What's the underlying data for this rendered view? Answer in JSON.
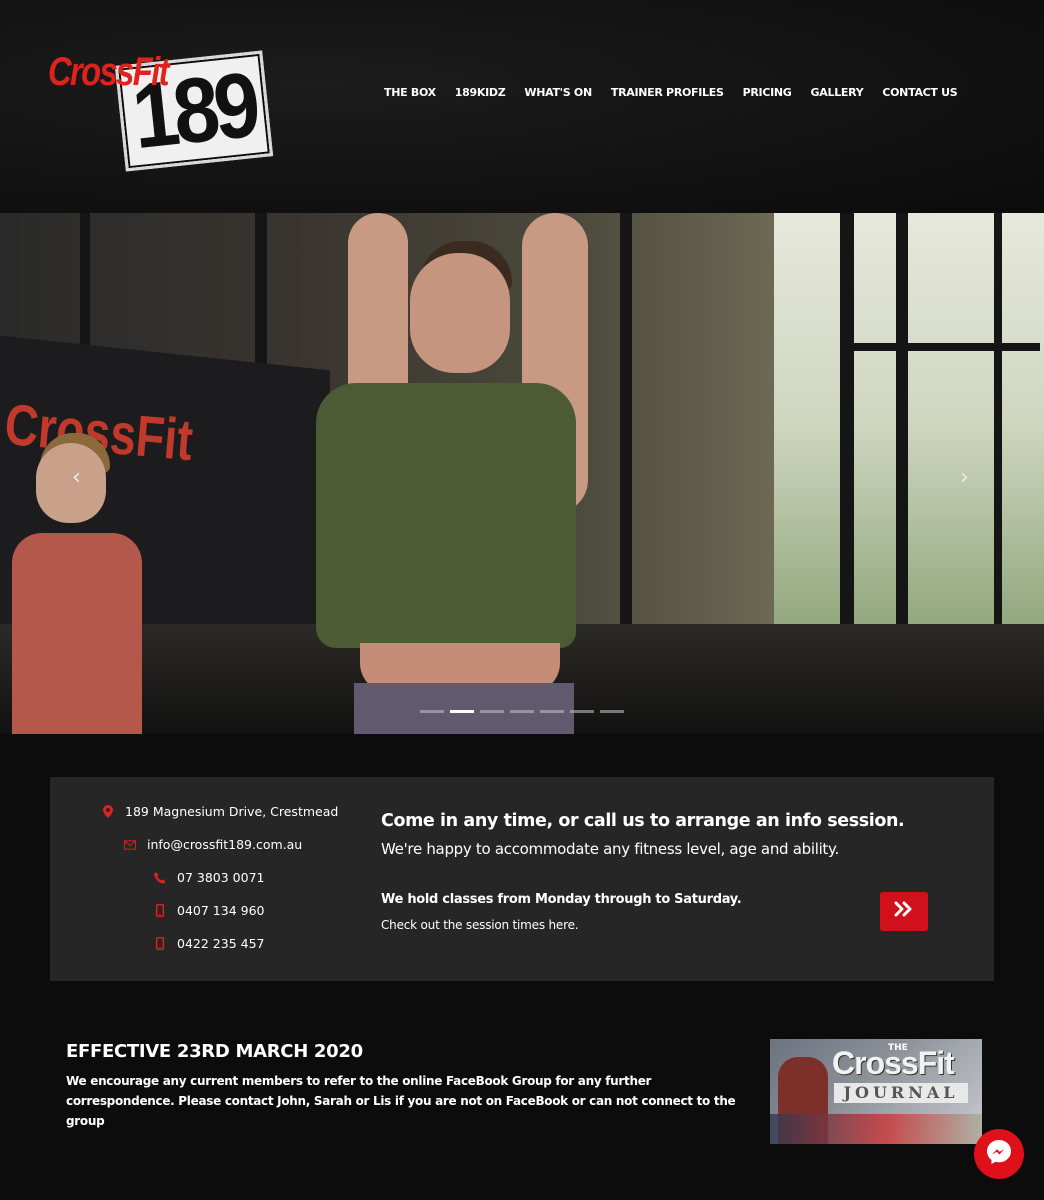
{
  "brand": {
    "logo_text_top": "CrossFit",
    "logo_text_number": "189",
    "accent_color": "#e0221c"
  },
  "nav": {
    "items": [
      {
        "label": "THE BOX"
      },
      {
        "label": "189KIDZ"
      },
      {
        "label": "WHAT'S ON"
      },
      {
        "label": "TRAINER PROFILES"
      },
      {
        "label": "PRICING"
      },
      {
        "label": "GALLERY"
      },
      {
        "label": "CONTACT US"
      }
    ]
  },
  "hero": {
    "prev_arrow": "‹",
    "next_arrow": "›",
    "slides_count": 7,
    "active_slide": 2,
    "wall_sign_text": "CrossFit"
  },
  "contact": {
    "address": "189 Magnesium Drive, Crestmead",
    "email": "info@crossfit189.com.au",
    "phone": "07 3803 0071",
    "mobile_1": "0407 134 960",
    "mobile_2": "0422 235 457",
    "icons": [
      "map-pin-icon",
      "envelope-icon",
      "phone-icon",
      "mobile-icon",
      "mobile-icon"
    ]
  },
  "info": {
    "heading": "Come in any time, or call us to arrange an info session.",
    "subheading": "We're happy to accommodate any fitness level, age and ability.",
    "classes": "We hold classes from Monday through to Saturday.",
    "session_link": "Check out the session times here.",
    "button_icon": "double-chevron-right-icon"
  },
  "announcement": {
    "title": "EFFECTIVE 23RD MARCH 2020",
    "body": "We encourage any current members to refer to the online FaceBook Group for any further correspondence. Please contact John, Sarah or Lis if you are not on FaceBook or can not connect to the group"
  },
  "journal_banner": {
    "the": "THE",
    "crossfit": "CrossFit",
    "journal": "JOURNAL"
  },
  "messenger": {
    "icon": "messenger-icon",
    "color": "#e0101a"
  }
}
